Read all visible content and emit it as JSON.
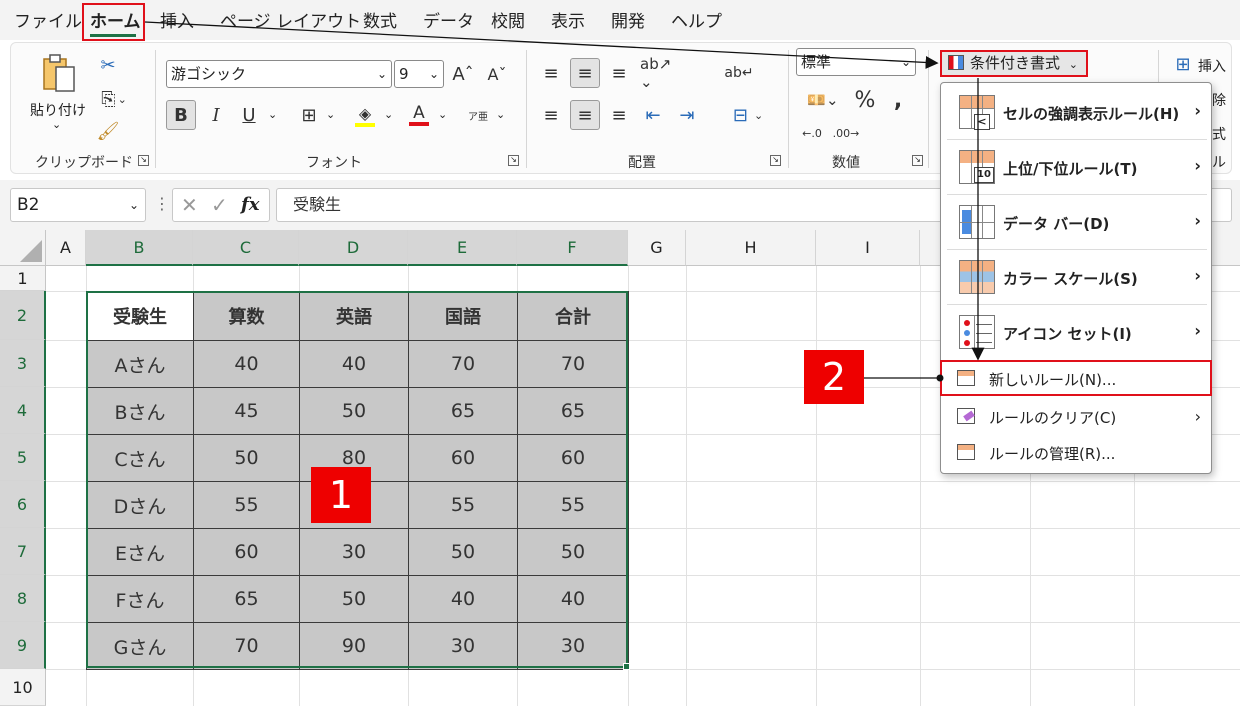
{
  "menu": {
    "tabs": [
      "ファイル",
      "ホーム",
      "挿入",
      "ページ レイアウト",
      "数式",
      "データ",
      "校閲",
      "表示",
      "開発",
      "ヘルプ"
    ]
  },
  "ribbon": {
    "clipboard": {
      "paste_label": "貼り付け",
      "group_label": "クリップボード"
    },
    "font": {
      "font_name": "游ゴシック",
      "font_size": "9",
      "bold": "B",
      "italic": "I",
      "underline": "U",
      "font_color_glyph": "A",
      "phonetic_glyph": "ア亜",
      "group_label": "フォント"
    },
    "alignment": {
      "group_label": "配置"
    },
    "number": {
      "format": "標準",
      "group_label": "数値"
    },
    "styles": {
      "conditional_format_label": "条件付き書式"
    },
    "cells": {
      "insert_label": "挿入",
      "delete_label": "削除",
      "format_label": "書式",
      "cells_label": "セル"
    }
  },
  "formula_bar": {
    "name_box": "B2",
    "fx": "fx",
    "value": "受験生"
  },
  "grid": {
    "columns": [
      "A",
      "B",
      "C",
      "D",
      "E",
      "F",
      "G",
      "H",
      "I"
    ],
    "rows": [
      "1",
      "2",
      "3",
      "4",
      "5",
      "6",
      "7",
      "8",
      "9",
      "10"
    ],
    "table": {
      "headers": [
        "受験生",
        "算数",
        "英語",
        "国語",
        "合計"
      ],
      "rows": [
        [
          "Aさん",
          "40",
          "40",
          "70",
          "70"
        ],
        [
          "Bさん",
          "45",
          "50",
          "65",
          "65"
        ],
        [
          "Cさん",
          "50",
          "80",
          "60",
          "60"
        ],
        [
          "Dさん",
          "55",
          "",
          "55",
          "55"
        ],
        [
          "Eさん",
          "60",
          "30",
          "50",
          "50"
        ],
        [
          "Fさん",
          "65",
          "50",
          "40",
          "40"
        ],
        [
          "Gさん",
          "70",
          "90",
          "30",
          "30"
        ]
      ]
    }
  },
  "annotations": {
    "step1": "1",
    "step2": "2"
  },
  "dropdown": {
    "items": [
      {
        "label": "セルの強調表示ルール(H)",
        "submenu": true,
        "icon": "highlight-cells-icon"
      },
      {
        "label": "上位/下位ルール(T)",
        "submenu": true,
        "icon": "top-bottom-icon"
      },
      {
        "label": "データ バー(D)",
        "submenu": true,
        "icon": "data-bars-icon"
      },
      {
        "label": "カラー スケール(S)",
        "submenu": true,
        "icon": "color-scales-icon"
      },
      {
        "label": "アイコン セット(I)",
        "submenu": true,
        "icon": "icon-sets-icon"
      },
      {
        "label": "新しいルール(N)...",
        "submenu": false,
        "icon": "new-rule-icon"
      },
      {
        "label": "ルールのクリア(C)",
        "submenu": true,
        "icon": "clear-rules-icon"
      },
      {
        "label": "ルールの管理(R)...",
        "submenu": false,
        "icon": "manage-rules-icon"
      }
    ],
    "icon_labels": {
      "less_than": "<",
      "ten": "10"
    }
  },
  "colors": {
    "accent_green": "#1e7145",
    "highlight_red": "#e0101a",
    "badge_red": "#ee0000"
  }
}
